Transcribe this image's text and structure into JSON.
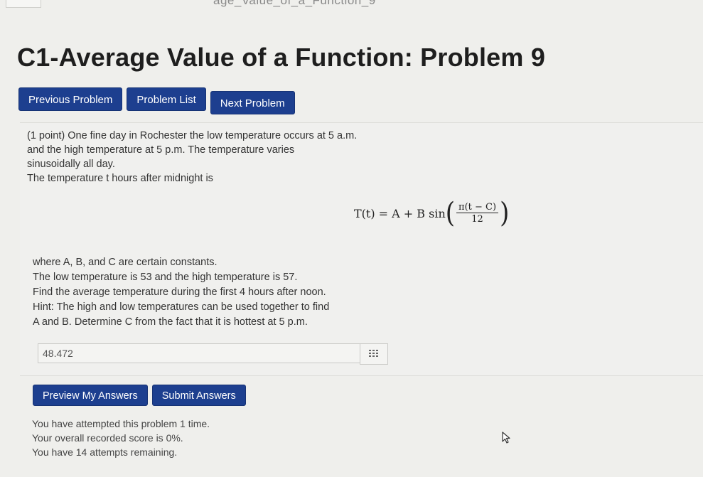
{
  "header": {
    "partial_text": "age_Value_of_a_Function_9",
    "title": "C1-Average Value of a Function: Problem 9"
  },
  "nav": {
    "previous_label": "Previous Problem",
    "list_label": "Problem List",
    "next_label": "Next Problem"
  },
  "problem": {
    "intro_line1": "(1 point) One fine day in Rochester the low temperature occurs at 5 a.m.",
    "intro_line2": "and the high temperature at 5 p.m. The temperature varies",
    "intro_line3": "sinusoidally all day.",
    "intro_line4": "The temperature t hours after midnight is",
    "formula_lhs": "T(t) = A + B sin",
    "formula_num": "π(t − C)",
    "formula_den": "12",
    "detail_line1": "where A, B, and C are certain constants.",
    "detail_line2": "The low temperature is 53 and the high temperature is 57.",
    "detail_line3": "Find the average temperature during the first 4 hours after noon.",
    "detail_line4": "Hint: The high and low temperatures can be used together to find",
    "detail_line5": "A and B. Determine C from the fact that it is hottest at 5 p.m."
  },
  "answer": {
    "value": "48.472",
    "keypad_icon": "keypad-grid-icon"
  },
  "actions": {
    "preview_label": "Preview My Answers",
    "submit_label": "Submit Answers"
  },
  "status": {
    "line1": "You have attempted this problem 1 time.",
    "line2": "Your overall recorded score is 0%.",
    "line3": "You have 14 attempts remaining."
  },
  "colors": {
    "button": "#1d3f8f",
    "background": "#efefec"
  }
}
